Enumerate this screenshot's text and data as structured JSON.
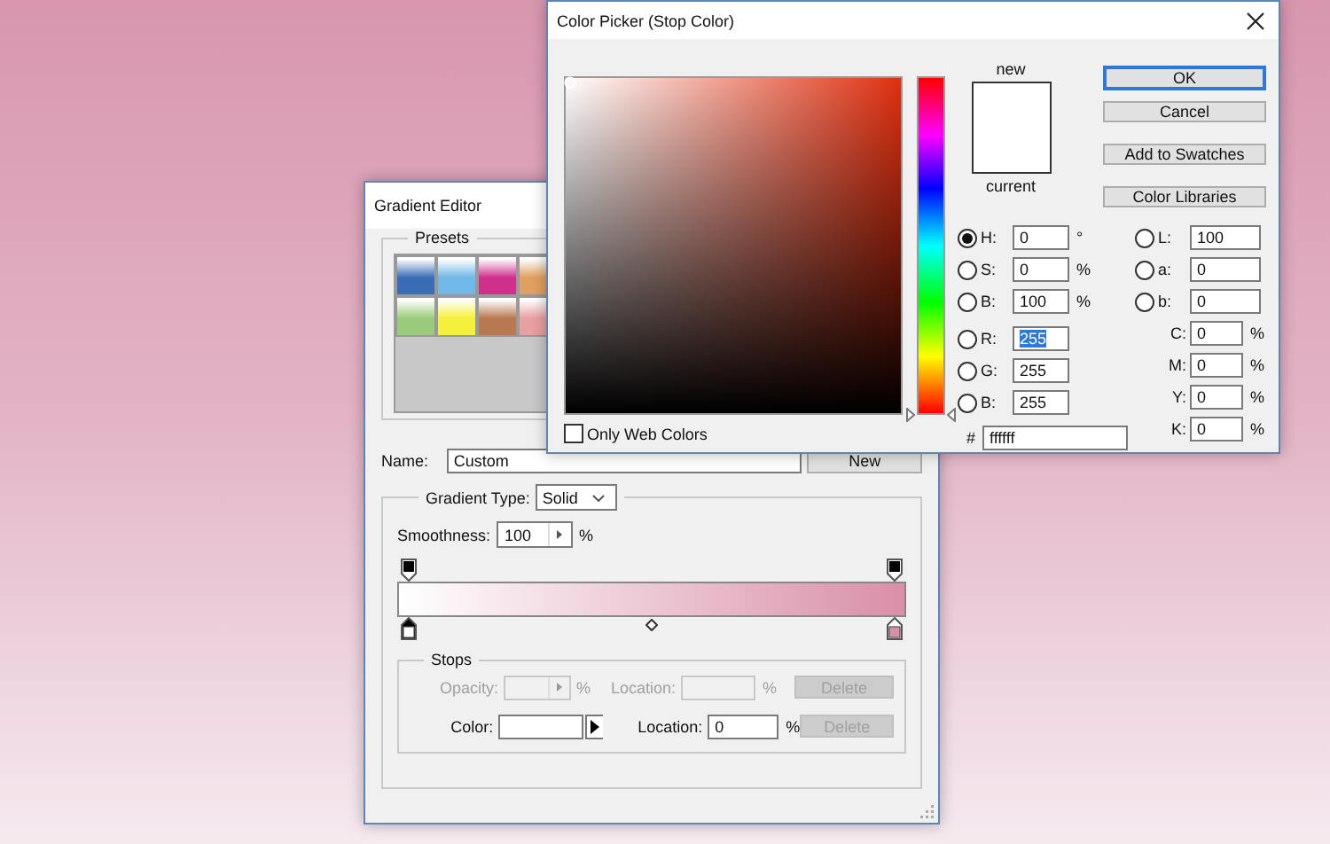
{
  "gradient_editor": {
    "title": "Gradient Editor",
    "presets_label": "Presets",
    "presets": [
      {
        "color": "#3a6db5"
      },
      {
        "color": "#6fb8e8"
      },
      {
        "color": "#d0308c"
      },
      {
        "color": "#e0a060"
      },
      {
        "color": "#9acb7a"
      },
      {
        "color": "#f5f03a"
      },
      {
        "color": "#b87850"
      },
      {
        "color": "#e8a0a0"
      }
    ],
    "name_label": "Name:",
    "name_value": "Custom",
    "new_button": "New",
    "gradient_type_label": "Gradient Type:",
    "gradient_type_value": "Solid",
    "smoothness_label": "Smoothness:",
    "smoothness_value": "100",
    "smoothness_unit": "%",
    "color_stops": [
      {
        "color": "#ffffff",
        "selected": true
      },
      {
        "color": "#d98fa8",
        "selected": false
      }
    ],
    "stops_label": "Stops",
    "stop_rows": [
      {
        "kind": "opacity",
        "label": "Opacity:",
        "unit": "%",
        "location_label": "Location:",
        "location_unit": "%",
        "delete": "Delete",
        "disabled": true
      },
      {
        "kind": "color",
        "label": "Color:",
        "location_label": "Location:",
        "location_value": "0",
        "location_unit": "%",
        "delete": "Delete",
        "disabled": false
      }
    ]
  },
  "color_picker": {
    "title": "Color Picker (Stop Color)",
    "new_label": "new",
    "current_label": "current",
    "buttons": [
      {
        "label": "OK",
        "default": true
      },
      {
        "label": "Cancel",
        "default": false
      },
      {
        "label": "Add to Swatches",
        "default": false
      },
      {
        "label": "Color Libraries",
        "default": false
      }
    ],
    "hue_slider": {
      "level": 0
    },
    "only_web_colors": {
      "label": "Only Web Colors",
      "checked": false
    },
    "left_fields": [
      {
        "kind": "radio",
        "label": "H:",
        "value": "0",
        "unit": "°",
        "selected": true,
        "highlighted": false
      },
      {
        "kind": "radio",
        "label": "S:",
        "value": "0",
        "unit": "%",
        "selected": false,
        "highlighted": false
      },
      {
        "kind": "radio",
        "label": "B:",
        "value": "100",
        "unit": "%",
        "selected": false,
        "highlighted": false
      },
      {
        "kind": "radio",
        "label": "R:",
        "value": "255",
        "selected": false,
        "highlighted": true
      },
      {
        "kind": "radio",
        "label": "G:",
        "value": "255",
        "selected": false,
        "highlighted": false
      },
      {
        "kind": "radio",
        "label": "B:",
        "value": "255",
        "selected": false,
        "highlighted": false
      }
    ],
    "right_fields": [
      {
        "kind": "radio",
        "label": "L:",
        "value": "100",
        "selected": false,
        "highlighted": false
      },
      {
        "kind": "radio",
        "label": "a:",
        "value": "0",
        "selected": false,
        "highlighted": false
      },
      {
        "kind": "radio",
        "label": "b:",
        "value": "0",
        "selected": false,
        "highlighted": false
      },
      {
        "kind": "plain",
        "label": "C:",
        "value": "0",
        "unit": "%",
        "highlighted": false
      },
      {
        "kind": "plain",
        "label": "M:",
        "value": "0",
        "unit": "%",
        "highlighted": false
      },
      {
        "kind": "plain",
        "label": "Y:",
        "value": "0",
        "unit": "%",
        "highlighted": false
      },
      {
        "kind": "plain",
        "label": "K:",
        "value": "0",
        "unit": "%",
        "highlighted": false
      }
    ],
    "hex": {
      "label": "#",
      "value": "ffffff"
    }
  }
}
